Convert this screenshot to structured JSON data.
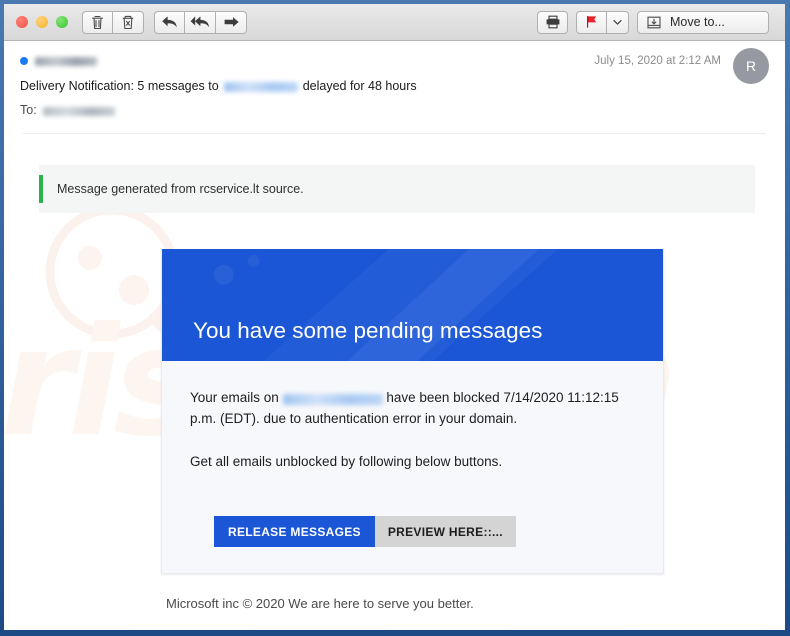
{
  "window": {
    "traffic_lights": [
      {
        "name": "close",
        "color": "#f2544b"
      },
      {
        "name": "minimize",
        "color": "#f5b32b"
      },
      {
        "name": "zoom",
        "color": "#2fc52a"
      }
    ]
  },
  "toolbar": {
    "left_buttons": [
      {
        "name": "delete",
        "icon": "trash-icon",
        "tooltip": "Delete"
      },
      {
        "name": "junk",
        "icon": "junk-trash-icon",
        "tooltip": "Junk"
      }
    ],
    "reply_buttons": [
      {
        "name": "reply",
        "icon": "reply-arrow-icon",
        "tooltip": "Reply"
      },
      {
        "name": "reply-all",
        "icon": "reply-all-arrow-icon",
        "tooltip": "Reply All"
      },
      {
        "name": "forward",
        "icon": "forward-arrow-icon",
        "tooltip": "Forward"
      }
    ],
    "right_buttons": [
      {
        "name": "print",
        "icon": "printer-icon",
        "tooltip": "Print"
      },
      {
        "name": "flag",
        "icon": "flag-icon",
        "color": "#e8222a",
        "tooltip": "Flag"
      },
      {
        "name": "flag-menu",
        "icon": "chevron-down-icon",
        "tooltip": "Flag options"
      }
    ],
    "move_to_label": "Move to...",
    "move_to_icon": "move-to-folder-icon"
  },
  "message": {
    "sender_redacted": true,
    "unread": true,
    "subject_parts": {
      "before": "Delivery Notification: 5 messages to",
      "after": "delayed for 48 hours"
    },
    "to_label": "To:",
    "to_redacted": true,
    "date": "July 15, 2020 at 2:12 AM",
    "avatar_initial": "R"
  },
  "notice": {
    "text": "Message generated from rcservice.lt source.",
    "accent_color": "#2bb34a"
  },
  "phish_card": {
    "banner_title": "You have some pending messages",
    "banner_color": "#1a56d6",
    "paragraph1": {
      "before": "Your emails on",
      "after": "have been blocked 7/14/2020 11:12:15 p.m. (EDT). due to authentication error in your domain."
    },
    "paragraph2": "Get all emails unblocked by following below buttons.",
    "buttons": [
      {
        "label": "RELEASE  MESSAGES",
        "style": "primary"
      },
      {
        "label": "PREVIEW HERE::...",
        "style": "secondary"
      }
    ]
  },
  "footer": {
    "text": "Microsoft inc © 2020 We are here to serve you better."
  },
  "watermark": {
    "text": "risk.com"
  }
}
